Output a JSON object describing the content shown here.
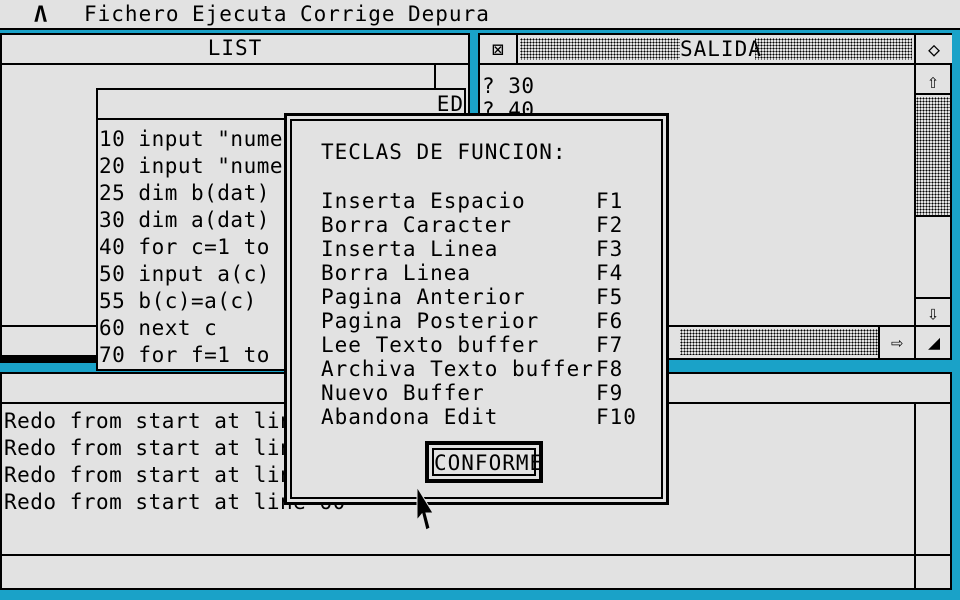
{
  "menu": {
    "logo": "Λ",
    "items": [
      "Fichero",
      "Ejecuta",
      "Corrige",
      "Depura"
    ]
  },
  "list_window": {
    "title": "LIST"
  },
  "edit_window": {
    "title": "ED",
    "lines": [
      "10 input \"numero",
      "20 input \"numero",
      "25 dim b(dat)",
      "30 dim a(dat)",
      "40 for c=1 to da",
      "50 input a(c)",
      "55 b(c)=a(c)",
      "60 next c",
      "70 for f=1 to da"
    ]
  },
  "output_window": {
    "title": "SALIDA",
    "lines": [
      "? 30",
      "? 40"
    ],
    "close_glyph": "⊠",
    "full_glyph": "◇",
    "up_glyph": "⇧",
    "down_glyph": "⇩",
    "right_glyph": "⇨",
    "size_glyph": "◢"
  },
  "console_window": {
    "lines": [
      "Redo from start at line",
      "Redo from start at line",
      "Redo from start at line",
      "Redo from start at line 60"
    ]
  },
  "dialog": {
    "title": "TECLAS DE FUNCION:",
    "rows": [
      {
        "label": "Inserta Espacio",
        "key": "F1"
      },
      {
        "label": "Borra Caracter",
        "key": "F2"
      },
      {
        "label": "Inserta Linea",
        "key": "F3"
      },
      {
        "label": "Borra Linea",
        "key": "F4"
      },
      {
        "label": "Pagina Anterior",
        "key": "F5"
      },
      {
        "label": "Pagina Posterior",
        "key": "F6"
      },
      {
        "label": "Lee Texto buffer",
        "key": "F7"
      },
      {
        "label": "Archiva Texto buffer",
        "key": "F8"
      },
      {
        "label": "Nuevo Buffer",
        "key": "F9"
      },
      {
        "label": "Abandona Edit",
        "key": "F10"
      }
    ],
    "ok_label": "CONFORME"
  }
}
